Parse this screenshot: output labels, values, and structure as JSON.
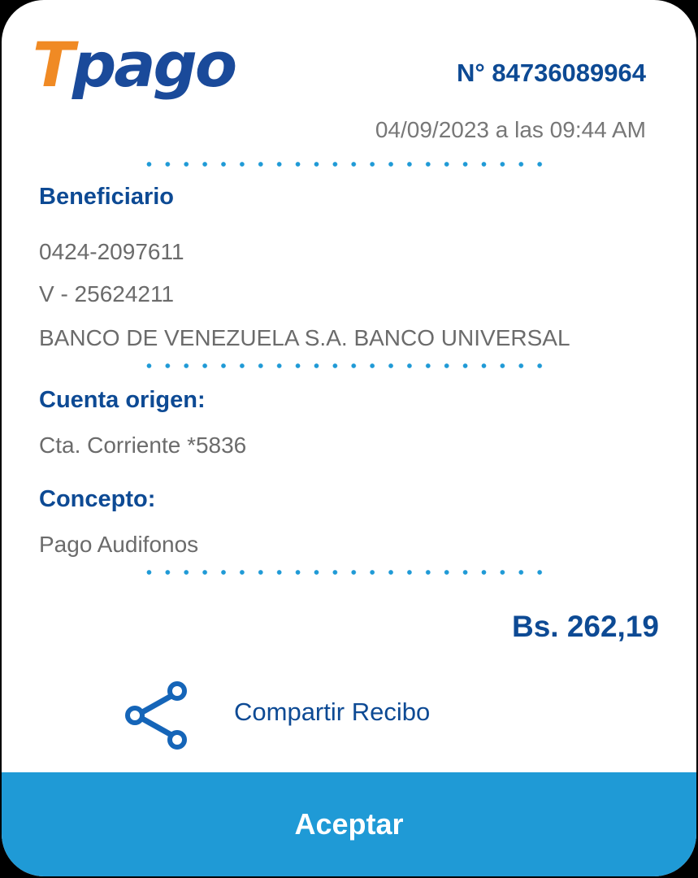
{
  "logo": {
    "letter": "T",
    "rest": "pago"
  },
  "receipt": {
    "number": "N° 84736089964",
    "datetime": "04/09/2023 a las 09:44 AM"
  },
  "beneficiary": {
    "heading": "Beneficiario",
    "phone": "0424-2097611",
    "id": "V - 25624211",
    "bank": "BANCO DE VENEZUELA S.A. BANCO UNIVERSAL"
  },
  "origin": {
    "heading": "Cuenta origen:",
    "account": "Cta. Corriente *5836"
  },
  "concept": {
    "heading": "Concepto:",
    "text": "Pago Audifonos"
  },
  "amount": "Bs. 262,19",
  "share": {
    "label": "Compartir Recibo",
    "icon": "share-icon"
  },
  "accept": {
    "label": "Aceptar"
  },
  "colors": {
    "brand_blue": "#0d4a94",
    "brand_orange": "#f08a24",
    "accent": "#1f9ad6"
  }
}
